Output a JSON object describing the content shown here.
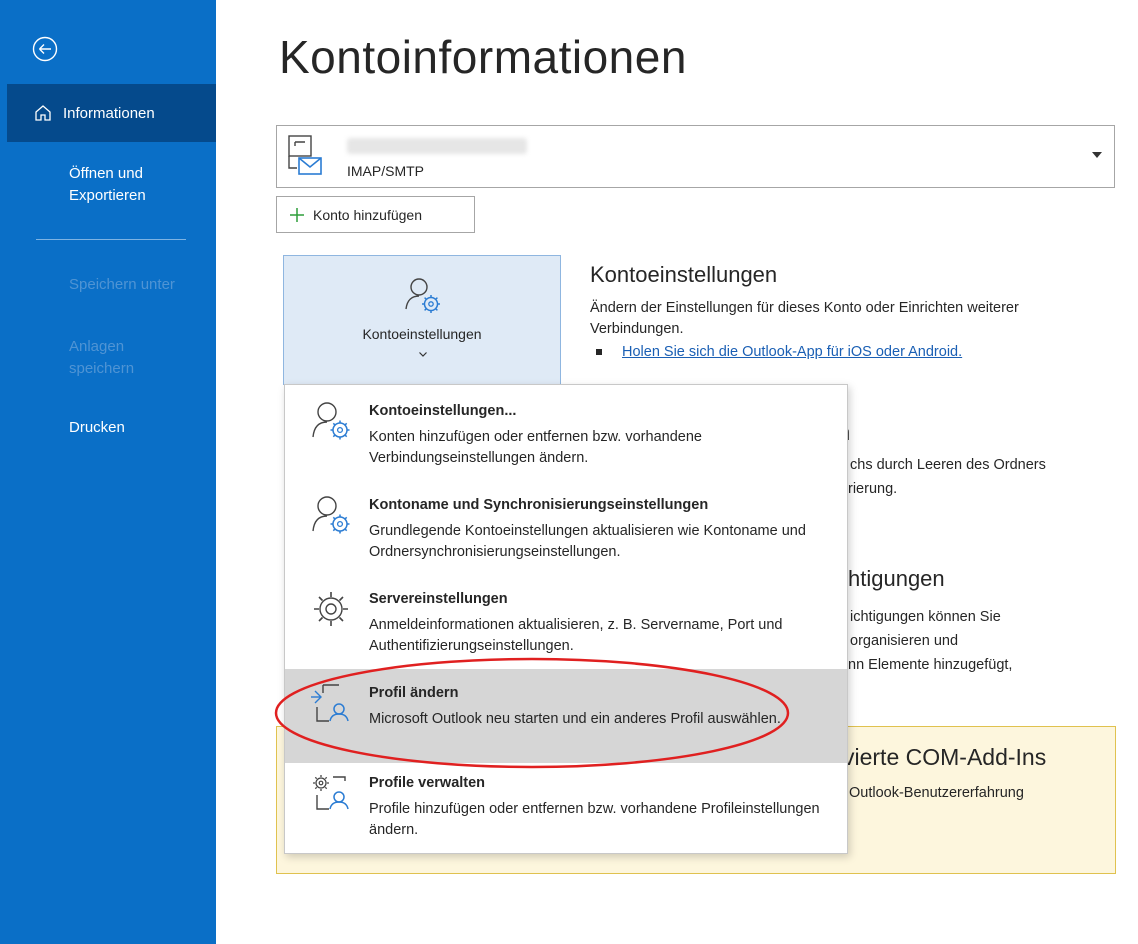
{
  "sidebar": {
    "back_icon": "back-arrow-circle-icon",
    "active_item": {
      "label": "Informationen",
      "icon": "home-icon"
    },
    "items": [
      {
        "label": "Öffnen und Exportieren",
        "line1": "Öffnen und",
        "line2": "Exportieren",
        "enabled": true
      },
      {
        "label": "Speichern unter",
        "enabled": false
      },
      {
        "label": "Anlagen speichern",
        "line1": "Anlagen",
        "line2": "speichern",
        "enabled": false
      },
      {
        "label": "Drucken",
        "enabled": true
      }
    ],
    "colors": {
      "background": "#0a6fc7",
      "active": "#054a8c",
      "disabled_text": "#4f94d4"
    }
  },
  "main": {
    "title": "Kontoinformationen",
    "account_selector": {
      "type": "IMAP/SMTP",
      "icon": "mailbox-icon",
      "email_redacted": true
    },
    "add_account_label": "Konto hinzufügen",
    "settings_tile": {
      "label": "Kontoeinstellungen",
      "icon": "account-settings-icon"
    },
    "account_settings_section": {
      "title": "Kontoeinstellungen",
      "description": "Ändern der Einstellungen für dieses Konto oder Einrichten weiterer Verbindungen.",
      "link": "Holen Sie sich die Outlook-App für iOS oder Android."
    },
    "partially_hidden": {
      "mailbox_title_fragment": "n",
      "mailbox_line1": "chs durch Leeren des Ordners",
      "mailbox_line2": "rierung.",
      "rules_title_fragment": "htigungen",
      "rules_line1": "ichtigungen können Sie",
      "rules_line2": "organisieren und",
      "rules_line3": "nn Elemente hinzugefügt,"
    },
    "com_addins": {
      "title": "vierte COM-Add-Ins",
      "text": "Outlook-Benutzererfahrung",
      "colors": {
        "background": "#fdf6dd",
        "border": "#e0c24f"
      }
    }
  },
  "dropdown": {
    "items": [
      {
        "title": "Kontoeinstellungen...",
        "description": "Konten hinzufügen oder entfernen bzw. vorhandene Verbindungseinstellungen ändern.",
        "icon": "account-settings-icon",
        "highlighted": false
      },
      {
        "title": "Kontoname und Synchronisierungseinstellungen",
        "description": "Grundlegende Kontoeinstellungen aktualisieren wie Kontoname und Ordnersynchronisierungseinstellungen.",
        "icon": "account-settings-icon",
        "highlighted": false
      },
      {
        "title": "Servereinstellungen",
        "description": "Anmeldeinformationen aktualisieren, z. B. Servername, Port und Authentifizierungseinstellungen.",
        "icon": "gear-icon",
        "highlighted": false
      },
      {
        "title": "Profil ändern",
        "description": "Microsoft Outlook neu starten und ein anderes Profil auswählen.",
        "icon": "switch-profile-icon",
        "highlighted": true
      },
      {
        "title": "Profile verwalten",
        "description": "Profile hinzufügen oder entfernen bzw. vorhandene Profileinstellungen ändern.",
        "icon": "manage-profiles-icon",
        "highlighted": false
      }
    ],
    "annotation_color": "#e02020"
  }
}
